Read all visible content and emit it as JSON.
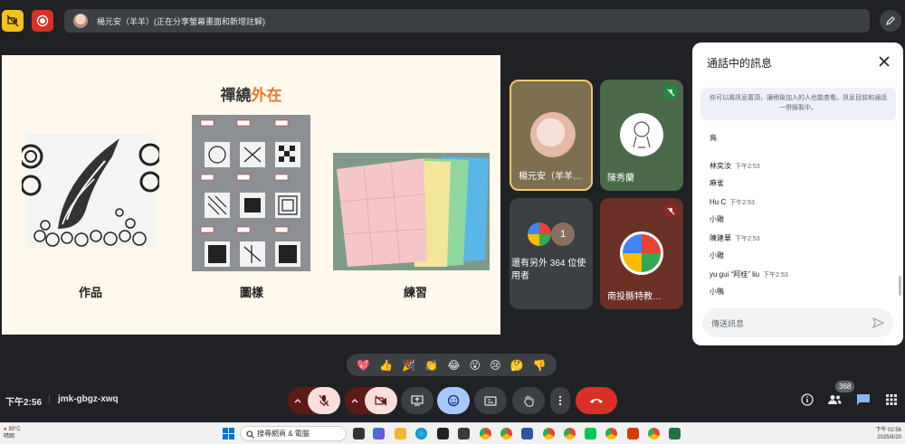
{
  "topbar": {
    "presenter_text": "楊元安（羊羊）(正在分享螢幕畫面和新增註解)"
  },
  "slide": {
    "title_main": "禪繞",
    "title_highlight": "外在",
    "captions": [
      "作品",
      "圖樣",
      "練習"
    ]
  },
  "tiles": [
    {
      "label": "楊元安（羊羊…"
    },
    {
      "label": "陳秀蘭"
    },
    {
      "label": "還有另外 364 位使用者",
      "count": "1"
    },
    {
      "label": "南投縣特教…"
    }
  ],
  "chat": {
    "title": "通話中的訊息",
    "note": "你可以將訊息置頂，讓稍後加入的人也能查看。訊息目前和通話一併錄製中。",
    "partial_text": "鳥",
    "messages": [
      {
        "name": "林奕汝",
        "time": "下午2:53",
        "text": "麻雀"
      },
      {
        "name": "Hu C",
        "time": "下午2:53",
        "text": "小雞"
      },
      {
        "name": "陳建華",
        "time": "下午2:53",
        "text": "小雞"
      },
      {
        "name": "yu gui “阿桂” liu",
        "time": "下午2:53",
        "text": "小鴨"
      }
    ],
    "input_placeholder": "傳送訊息"
  },
  "reactions": [
    "💖",
    "👍",
    "🎉",
    "👏",
    "😂",
    "😮",
    "😢",
    "🤔",
    "👎"
  ],
  "bottombar": {
    "time": "下午2:56",
    "separator": "|",
    "meeting_code": "jmk-gbgz-xwq",
    "participants_badge": "368"
  },
  "taskbar": {
    "temperature": "30°C",
    "weather": "晴朗",
    "search_placeholder": "搜尋網頁 & 電腦",
    "clock_time": "下午 02:56",
    "clock_date": "2025/8/20"
  },
  "colors": {
    "accent_orange": "#e87a2b",
    "end_call_red": "#d93025",
    "active_blue": "#a8c7fa",
    "presenter_border": "#f5c96a"
  }
}
